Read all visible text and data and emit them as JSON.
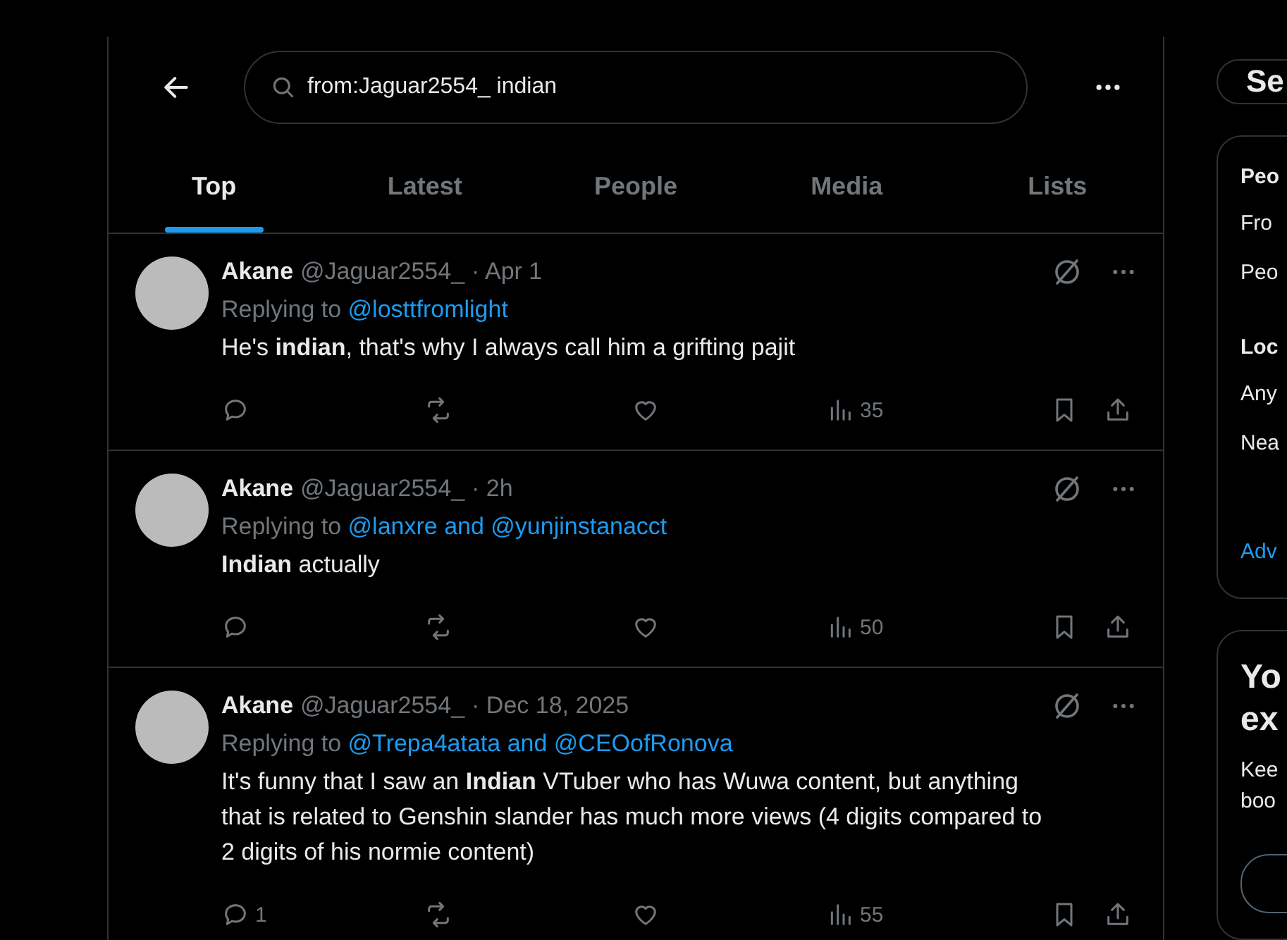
{
  "search": {
    "value": "from:Jaguar2554_ indian"
  },
  "tabs": [
    {
      "label": "Top",
      "selected": true
    },
    {
      "label": "Latest",
      "selected": false
    },
    {
      "label": "People",
      "selected": false
    },
    {
      "label": "Media",
      "selected": false
    },
    {
      "label": "Lists",
      "selected": false
    }
  ],
  "tweets": [
    {
      "name": "Akane",
      "handle": "@Jaguar2554_",
      "time": "· Apr 1",
      "replying_label": "Replying to",
      "replying_to": "@losttfromlight",
      "text": "He's **indian**, that's why I always call him a grifting pajit",
      "views": "35"
    },
    {
      "name": "Akane",
      "handle": "@Jaguar2554_",
      "time": "· 2h",
      "replying_label": "Replying to",
      "replying_to": "@lanxre and @yunjinstanacct",
      "text": "**Indian** actually",
      "views": "50"
    },
    {
      "name": "Akane",
      "handle": "@Jaguar2554_",
      "time": "· Dec 18, 2025",
      "replying_label": "Replying to",
      "replying_to": "@Trepa4atata and @CEOofRonova",
      "text": "It's funny that I saw an **Indian** VTuber who has Wuwa content, but anything that is related to Genshin slander has much more views (4 digits compared to 2 digits of his normie content)",
      "replies": "1",
      "views": "55"
    }
  ],
  "sidebar": {
    "search_field": "Se",
    "filters": [
      {
        "kind": "heading",
        "text": "Peo"
      },
      {
        "kind": "option",
        "text": "Fro"
      },
      {
        "kind": "option",
        "text": "Peo"
      },
      {
        "kind": "heading",
        "text": "Loc"
      },
      {
        "kind": "option",
        "text": "Any"
      },
      {
        "kind": "option",
        "text": "Nea"
      },
      {
        "kind": "link",
        "text": "Adv"
      }
    ],
    "promo": {
      "title_lines": [
        "Yo",
        "ex"
      ],
      "text_lines": [
        "Kee",
        "boo"
      ]
    }
  }
}
